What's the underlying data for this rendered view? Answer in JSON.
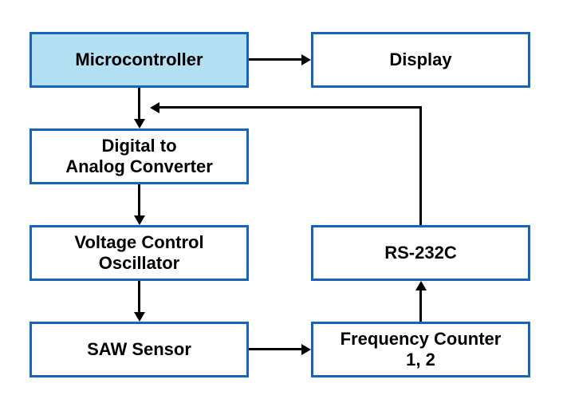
{
  "blocks": {
    "microcontroller": "Microcontroller",
    "display": "Display",
    "dac": "Digital to\nAnalog Converter",
    "vco": "Voltage Control\nOscillator",
    "saw": "SAW Sensor",
    "rs232c": "RS-232C",
    "freq_counter": "Frequency Counter\n1, 2"
  }
}
